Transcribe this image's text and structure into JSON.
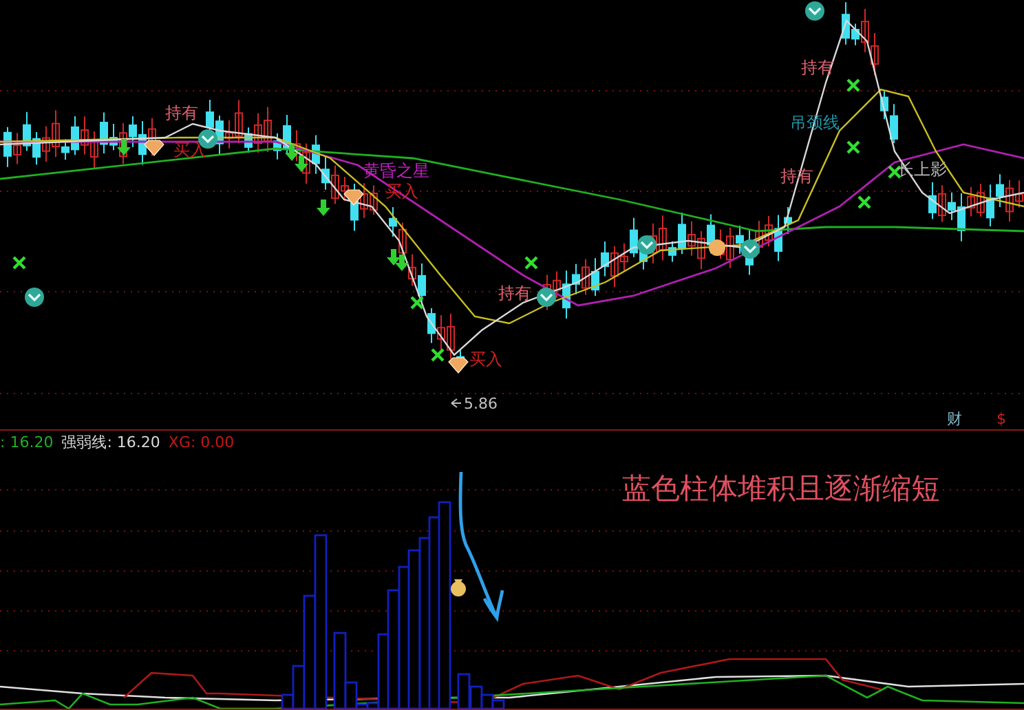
{
  "price_chart": {
    "signals": [
      {
        "text": "持有",
        "color": "#e06070"
      },
      {
        "text": "买入",
        "color": "#d02020"
      },
      {
        "text": "黄昏之星",
        "color": "#c020c0"
      },
      {
        "text": "买入",
        "color": "#d02020"
      },
      {
        "text": "买入",
        "color": "#d02020"
      },
      {
        "text": "持有",
        "color": "#e06070"
      },
      {
        "text": "持有",
        "color": "#e06070"
      },
      {
        "text": "吊颈线",
        "color": "#2098a8"
      },
      {
        "text": "持有",
        "color": "#e06070"
      },
      {
        "text": "长上影",
        "color": "#b8b8b8"
      }
    ],
    "low_marker": "5.86",
    "badges": [
      {
        "text": "财",
        "kind": "finance"
      },
      {
        "text": "$",
        "kind": "dollar"
      }
    ]
  },
  "indicator": {
    "legend": [
      {
        "text": ": 16.20",
        "color": "#20b020"
      },
      {
        "text": "强弱线: 16.20",
        "color": "#d8d8d8"
      },
      {
        "text": "XG: 0.00",
        "color": "#c01818"
      }
    ],
    "note": "蓝色柱体堆积且逐渐缩短"
  }
}
